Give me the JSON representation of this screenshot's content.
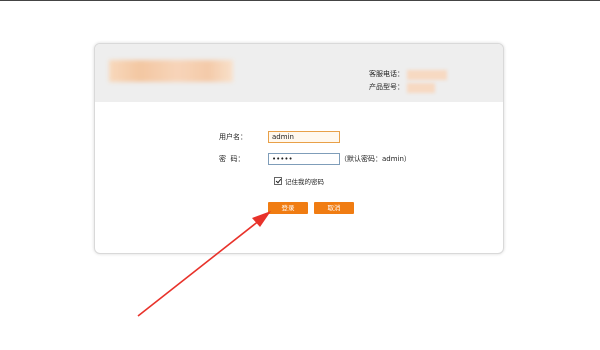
{
  "header": {
    "service_phone_label": "客服电话：",
    "product_model_label": "产品型号："
  },
  "form": {
    "username_label": "用户名：",
    "username_value": "admin",
    "password_label": "密  码：",
    "password_value": "•••••",
    "password_hint": "（默认密码：admin）",
    "remember_label": "记住我的密码",
    "remember_checked": true
  },
  "buttons": {
    "login_label": "登录",
    "cancel_label": "取消"
  },
  "colors": {
    "accent_orange": "#f07c12",
    "annotation_red": "#e8322a",
    "header_bg": "#eeeeee"
  }
}
